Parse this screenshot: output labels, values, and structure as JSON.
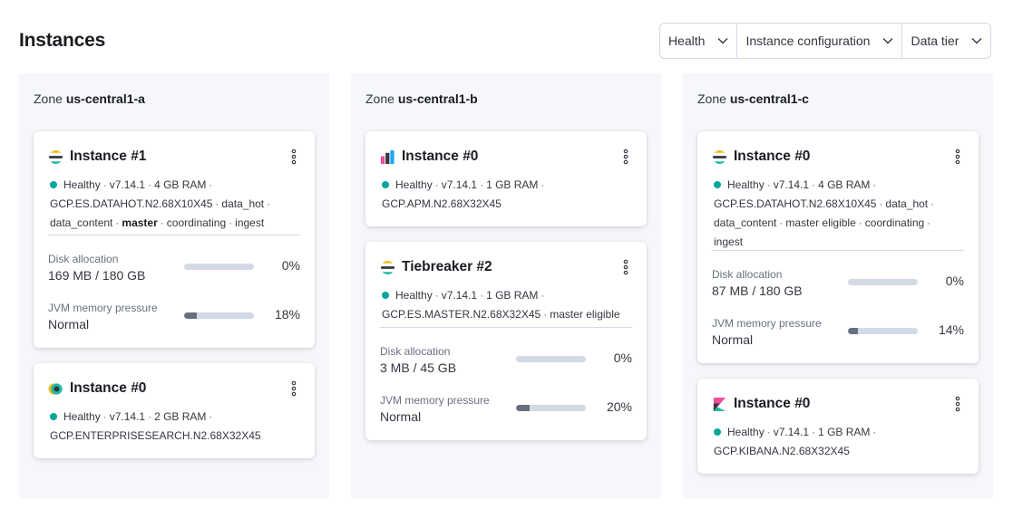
{
  "page": {
    "title": "Instances"
  },
  "filters": [
    {
      "label": "Health"
    },
    {
      "label": "Instance configuration"
    },
    {
      "label": "Data tier"
    }
  ],
  "zones": [
    {
      "prefix": "Zone",
      "name": "us-central1-a",
      "cards": [
        {
          "title": "Instance #1",
          "icon": "elasticsearch-icon",
          "health": "Healthy",
          "version": "v7.14.1",
          "ram": "4 GB RAM",
          "config": "GCP.ES.DATAHOT.N2.68X10X45",
          "roles": [
            "data_hot",
            "data_content",
            "master",
            "coordinating",
            "ingest"
          ],
          "disk": {
            "label": "Disk allocation",
            "value": "169 MB / 180 GB",
            "percent": 0,
            "percent_text": "0%"
          },
          "jvm": {
            "label": "JVM memory pressure",
            "value": "Normal",
            "percent": 18,
            "percent_text": "18%"
          }
        },
        {
          "title": "Instance #0",
          "icon": "enterprise-search-icon",
          "health": "Healthy",
          "version": "v7.14.1",
          "ram": "2 GB RAM",
          "config": "GCP.ENTERPRISESEARCH.N2.68X32X45"
        }
      ]
    },
    {
      "prefix": "Zone",
      "name": "us-central1-b",
      "cards": [
        {
          "title": "Instance #0",
          "icon": "apm-icon",
          "health": "Healthy",
          "version": "v7.14.1",
          "ram": "1 GB RAM",
          "config": "GCP.APM.N2.68X32X45"
        },
        {
          "title": "Tiebreaker #2",
          "icon": "elasticsearch-icon",
          "health": "Healthy",
          "version": "v7.14.1",
          "ram": "1 GB RAM",
          "config": "GCP.ES.MASTER.N2.68X32X45",
          "roles": [
            "master eligible"
          ],
          "disk": {
            "label": "Disk allocation",
            "value": "3 MB / 45 GB",
            "percent": 0,
            "percent_text": "0%"
          },
          "jvm": {
            "label": "JVM memory pressure",
            "value": "Normal",
            "percent": 20,
            "percent_text": "20%"
          }
        }
      ]
    },
    {
      "prefix": "Zone",
      "name": "us-central1-c",
      "cards": [
        {
          "title": "Instance #0",
          "icon": "elasticsearch-icon",
          "health": "Healthy",
          "version": "v7.14.1",
          "ram": "4 GB RAM",
          "config": "GCP.ES.DATAHOT.N2.68X10X45",
          "roles": [
            "data_hot",
            "data_content",
            "master eligible",
            "coordinating",
            "ingest"
          ],
          "disk": {
            "label": "Disk allocation",
            "value": "87 MB / 180 GB",
            "percent": 0,
            "percent_text": "0%"
          },
          "jvm": {
            "label": "JVM memory pressure",
            "value": "Normal",
            "percent": 14,
            "percent_text": "14%"
          }
        },
        {
          "title": "Instance #0",
          "icon": "kibana-icon",
          "health": "Healthy",
          "version": "v7.14.1",
          "ram": "1 GB RAM",
          "config": "GCP.KIBANA.N2.68X32X45"
        }
      ]
    }
  ],
  "colors": {
    "healthy": "#00a69b",
    "bar_track": "#d3dae6",
    "bar_fill": "#69707d",
    "zone_bg": "#f5f7fa"
  }
}
